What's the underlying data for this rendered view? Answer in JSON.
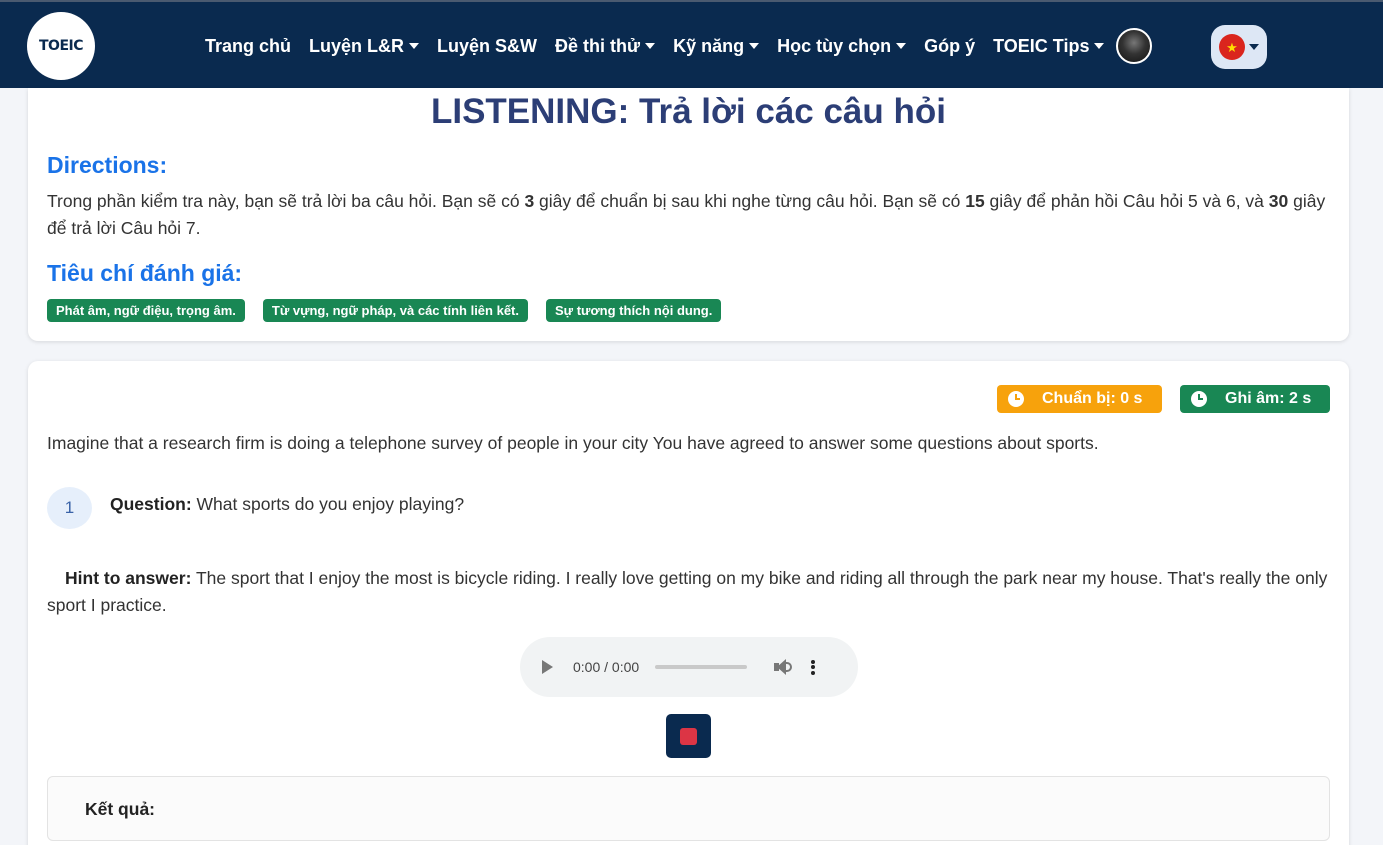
{
  "nav": {
    "logo_text": "TOEIC",
    "items": [
      {
        "label": "Trang chủ",
        "dropdown": false
      },
      {
        "label": "Luyện L&R",
        "dropdown": true
      },
      {
        "label": "Luyện S&W",
        "dropdown": false
      },
      {
        "label": "Đề thi thử",
        "dropdown": true
      },
      {
        "label": "Kỹ năng",
        "dropdown": true
      },
      {
        "label": "Học tùy chọn",
        "dropdown": true
      },
      {
        "label": "Góp ý",
        "dropdown": false
      },
      {
        "label": "TOEIC Tips",
        "dropdown": true
      }
    ],
    "language_flag": "vietnam-flag-icon",
    "flag_star": "★"
  },
  "section": {
    "title": "LISTENING: Trả lời các câu hỏi",
    "directions_heading": "Directions:",
    "directions": {
      "p1": "Trong phần kiểm tra này, bạn sẽ trả lời ba câu hỏi. Bạn sẽ có ",
      "n1": "3",
      "p2": " giây để chuẩn bị sau khi nghe từng câu hỏi. Bạn sẽ có ",
      "n2": "15",
      "p3": " giây để phản hồi Câu hỏi 5 và 6, và ",
      "n3": "30",
      "p4": " giây để trả lời Câu hỏi 7."
    },
    "criteria_heading": "Tiêu chí đánh giá:",
    "criteria": [
      "Phát âm, ngữ điệu, trọng âm.",
      "Từ vựng, ngữ pháp, và các tính liên kết.",
      "Sự tương thích nội dung."
    ]
  },
  "task": {
    "timer_prepare": "Chuẩn bị: 0 s",
    "timer_record": "Ghi âm: 2 s",
    "intro": "Imagine that a research firm is doing a telephone survey of people in your city You have agreed to answer some questions about sports.",
    "question_number": "1",
    "question_label": "Question:",
    "question_text": " What sports do you enjoy playing?",
    "hint_label": "Hint to answer:",
    "hint_text": " The sport that I enjoy the most is bicycle riding. I really love getting on my bike and riding all through the park near my house. That's really the only sport I practice.",
    "audio_time": "0:00 / 0:00",
    "result_label": "Kết quả:"
  },
  "colors": {
    "navbar": "#0a2a4f",
    "heading_blue": "#1a73e8",
    "title": "#2c3e76",
    "badge_green": "#198754",
    "timer_orange": "#f7a20c",
    "stop_red": "#dc3545"
  }
}
